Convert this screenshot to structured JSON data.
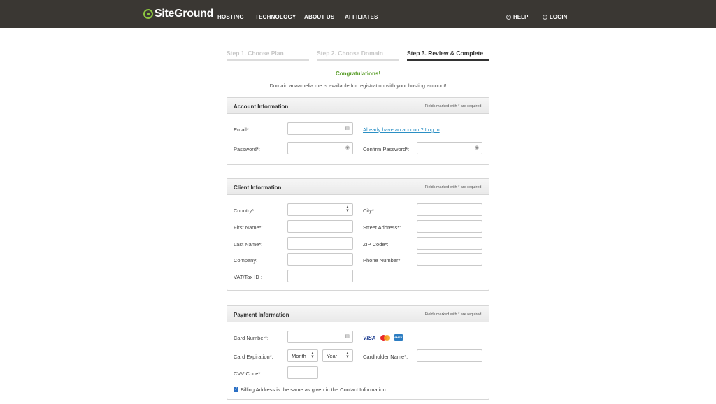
{
  "header": {
    "logo_text": "SiteGround",
    "nav": [
      "HOSTING",
      "TECHNOLOGY",
      "ABOUT US",
      "AFFILIATES"
    ],
    "help": "HELP",
    "login": "LOGIN"
  },
  "steps": [
    "Step 1. Choose Plan",
    "Step 2. Choose Domain",
    "Step 3. Review & Complete"
  ],
  "messages": {
    "congrats": "Congratulations!",
    "domain": "Domain anaamelia.me is available for registration with your hosting account!"
  },
  "account": {
    "title": "Account Information",
    "note": "Fields marked with * are required!",
    "email_label": "Email*:",
    "password_label": "Password*:",
    "login_link": "Already have an account? Log In",
    "confirm_label": "Confirm Password*:"
  },
  "client": {
    "title": "Client Information",
    "note": "Fields marked with * are required!",
    "country_label": "Country*:",
    "first_name_label": "First Name*:",
    "last_name_label": "Last Name*:",
    "company_label": "Company:",
    "vat_label": "VAT/Tax ID :",
    "city_label": "City*:",
    "street_label": "Street Address*:",
    "zip_label": "ZIP Code*:",
    "phone_label": "Phone Number*:"
  },
  "payment": {
    "title": "Payment Information",
    "note": "Fields marked with * are required!",
    "card_number_label": "Card Number*:",
    "expiration_label": "Card Expiration*:",
    "month_value": "Month",
    "year_value": "Year",
    "cardholder_label": "Cardholder Name*:",
    "cvv_label": "CVV Code*:",
    "billing_label": "Billing Address is the same as given in the Contact Information",
    "visa": "VISA",
    "amex": "AMEX"
  },
  "colors": {
    "header_bg": "#3a3733",
    "brand_green": "#8cc63f",
    "link": "#2a8fc4",
    "success": "#5a9e2a"
  }
}
